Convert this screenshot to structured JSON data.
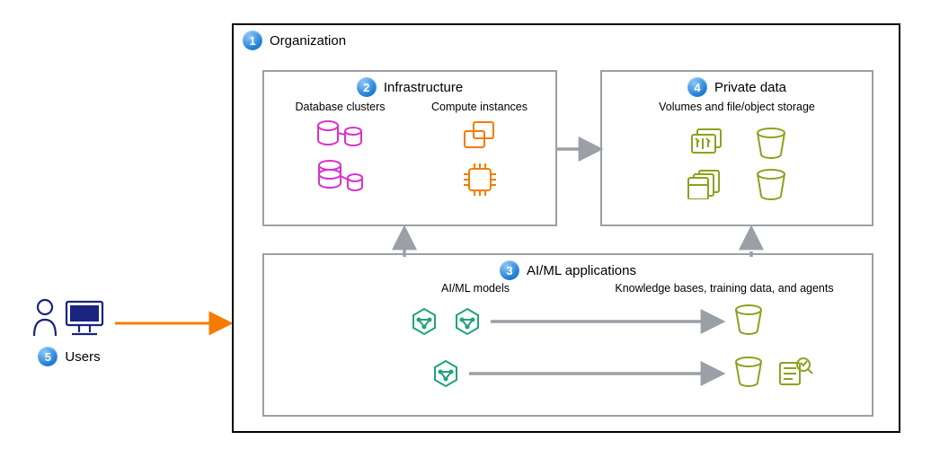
{
  "organization": {
    "label": "Organization",
    "badge": "1"
  },
  "infrastructure": {
    "label": "Infrastructure",
    "badge": "2",
    "db_label": "Database clusters",
    "compute_label": "Compute instances"
  },
  "private_data": {
    "label": "Private data",
    "badge": "4",
    "sublabel": "Volumes and file/object storage"
  },
  "aiml": {
    "label": "AI/ML applications",
    "badge": "3",
    "models_label": "AI/ML models",
    "knowledge_label": "Knowledge bases, training data, and agents"
  },
  "users": {
    "label": "Users",
    "badge": "5"
  },
  "colors": {
    "outline_black": "#000000",
    "box_gray": "#9aa0a6",
    "arrow_gray": "#9aa0a6",
    "arrow_orange": "#f57c00",
    "db_magenta": "#d633cc",
    "compute_orange": "#f57c00",
    "storage_olive": "#8aa31f",
    "aiml_teal": "#1fa37a",
    "users_navy": "#1a237e"
  }
}
